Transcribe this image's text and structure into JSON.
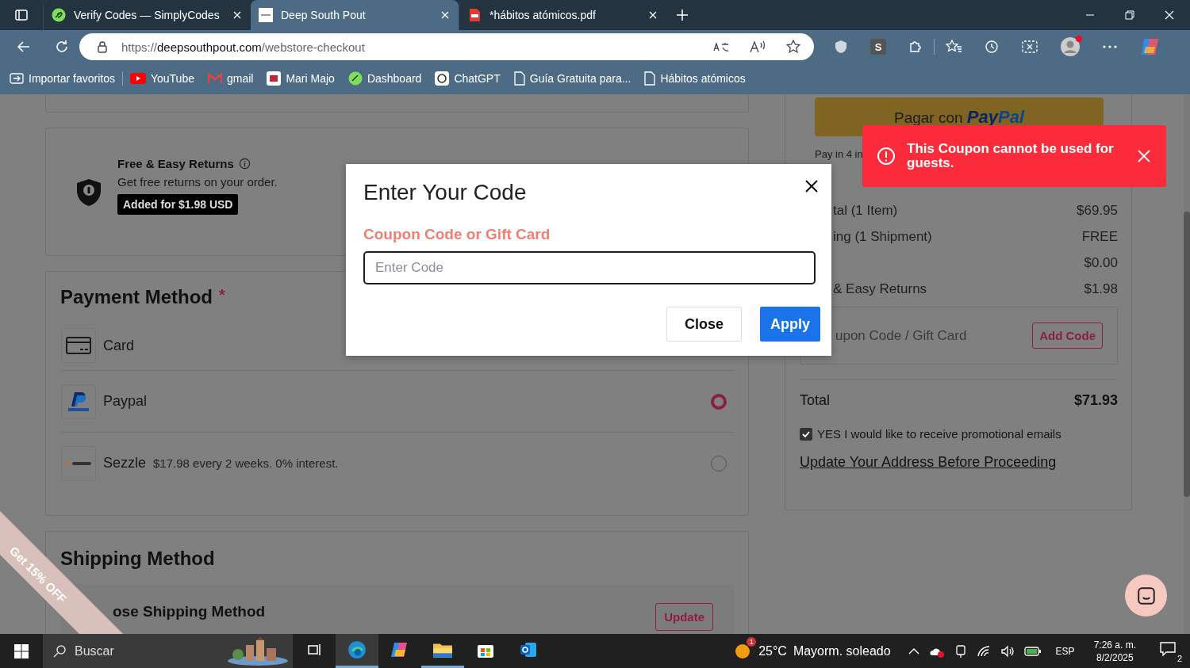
{
  "browser": {
    "tabs": [
      {
        "title": "Verify Codes — SimplyCodes",
        "selected": false
      },
      {
        "title": "Deep South Pout",
        "selected": true
      },
      {
        "title": "*hábitos atómicos.pdf",
        "selected": false
      }
    ],
    "address": {
      "prefix": "https://",
      "host": "deepsouthpout.com",
      "path": "/webstore-checkout"
    },
    "extension_badge": "S",
    "profile_notification": true,
    "bookmarks": [
      "Importar favoritos",
      "YouTube",
      "gmail",
      "Mari Majo",
      "Dashboard",
      "ChatGPT",
      "Guía Gratuita para...",
      "Hábitos atómicos"
    ]
  },
  "returns": {
    "title": "Free & Easy Returns",
    "text": "Get free returns on your order.",
    "badge": "Added for $1.98 USD"
  },
  "payment": {
    "title": "Payment Method",
    "required_mark": "*",
    "methods": [
      {
        "kind": "card",
        "label": "Card"
      },
      {
        "kind": "paypal",
        "label": "Paypal",
        "selected": true
      },
      {
        "kind": "sezzle",
        "label": "Sezzle",
        "note": "$17.98 every 2 weeks. 0% interest.",
        "selected": false
      }
    ]
  },
  "shipping": {
    "title": "Shipping Method",
    "choose_label": "ose Shipping Method",
    "update_button": "Update"
  },
  "promo_ribbon": "Get 15% OFF",
  "summary": {
    "paypal_button": {
      "prefix": "Pagar con",
      "brand_1": "Pay",
      "brand_2": "Pal"
    },
    "pay_in_4": "Pay in 4 in",
    "rows": [
      {
        "label": "tal (1 Item)",
        "value": "$69.95"
      },
      {
        "label": "ing (1 Shipment)",
        "value": "FREE"
      },
      {
        "label": "",
        "value": "$0.00"
      },
      {
        "label": "& Easy Returns",
        "value": "$1.98"
      }
    ],
    "coupon": {
      "placeholder": "upon Code / Gift Card",
      "button": "Add Code"
    },
    "total": {
      "label": "Total",
      "value": "$71.93"
    },
    "promo_emails": {
      "label": "YES I would like to receive promotional emails",
      "checked": true
    },
    "address_link": "Update Your Address Before Proceeding"
  },
  "modal": {
    "title": "Enter Your Code",
    "field_label": "Coupon Code or Gift Card",
    "placeholder": "Enter Code",
    "buttons": [
      "Close",
      "Apply"
    ]
  },
  "toast": {
    "message": "This Coupon cannot be used for guests."
  },
  "taskbar": {
    "search_placeholder": "Buscar",
    "apps": [
      {
        "kind": "task-view",
        "running": false
      },
      {
        "kind": "edge",
        "running": true
      },
      {
        "kind": "copilot",
        "running": false
      },
      {
        "kind": "explorer",
        "running": true
      },
      {
        "kind": "store",
        "running": false
      },
      {
        "kind": "outlook",
        "running": false
      }
    ],
    "weather": {
      "alert_count": "1",
      "temperature": "25°C",
      "condition": "Mayorm. soleado"
    },
    "language": "ESP",
    "time": "7:26 a. m.",
    "date": "8/2/2025",
    "notification_count": "2"
  }
}
